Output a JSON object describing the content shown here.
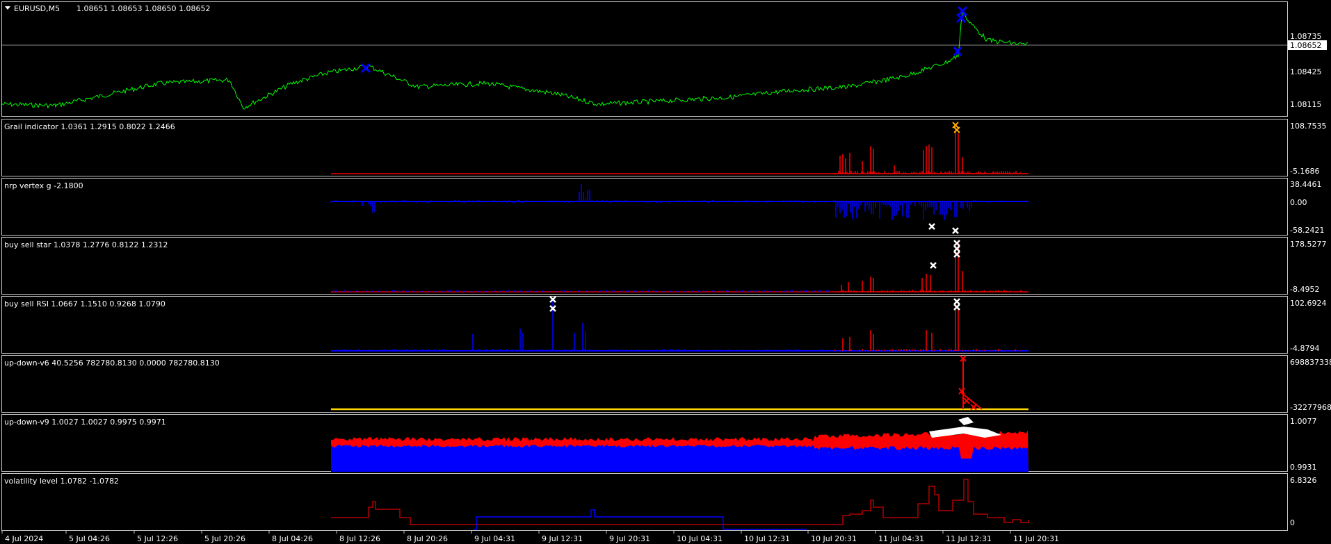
{
  "colors": {
    "background": "#000000",
    "border": "#c8c8c8",
    "text": "#ffffff",
    "price": "#00ff00",
    "blue": "#0000ff",
    "red": "#ff0000",
    "darkred": "#b00000",
    "white": "#ffffff",
    "orange": "#ffa500",
    "yellow": "#ffd700"
  },
  "main_chart": {
    "symbol_label": "EURUSD,M5",
    "ohlc": "1.08651 1.08653 1.08650 1.08652",
    "price_axis": [
      "1.08735",
      "1.08425",
      "1.08115"
    ],
    "current_price": "1.08652"
  },
  "panes": [
    {
      "id": "grail",
      "label": "Grail indicator 1.0361 1.2915 0.8022 1.2466",
      "axis_top": "108.7535",
      "axis_bottom": "-5.1686"
    },
    {
      "id": "nrp",
      "label": "nrp vertex g -2.1800",
      "axis_top": "38.4461",
      "axis_mid": "0.00",
      "axis_bottom": "-58.2421"
    },
    {
      "id": "bss",
      "label": "buy sell star 1.0378 1.2776 0.8122 1.2312",
      "axis_top": "178.5277",
      "axis_bottom": "-8.4952"
    },
    {
      "id": "rsi",
      "label": "buy sell RSI 1.0667 1.1510 0.9268 1.0790",
      "axis_top": "102.6924",
      "axis_bottom": "-4.8794"
    },
    {
      "id": "ud6",
      "label": "up-down-v6 40.5256 782780.8130 0.0000 782780.8130",
      "axis_top": "698837338",
      "axis_bottom": "-32277968"
    },
    {
      "id": "ud9",
      "label": "up-down-v9 1.0027 1.0027 0.9975 0.9971",
      "axis_top": "1.0077",
      "axis_bottom": "0.9931"
    },
    {
      "id": "vol",
      "label": "volatility level 1.0782 -1.0782",
      "axis_top": "6.8326",
      "axis_bottom": "0"
    }
  ],
  "time_axis": [
    "4 Jul 2024",
    "5 Jul 04:26",
    "5 Jul 12:26",
    "5 Jul 20:26",
    "8 Jul 04:26",
    "8 Jul 12:26",
    "8 Jul 20:26",
    "9 Jul 04:31",
    "9 Jul 12:31",
    "9 Jul 20:31",
    "10 Jul 04:31",
    "10 Jul 12:31",
    "10 Jul 20:31",
    "11 Jul 04:31",
    "11 Jul 12:31",
    "11 Jul 20:31"
  ]
}
